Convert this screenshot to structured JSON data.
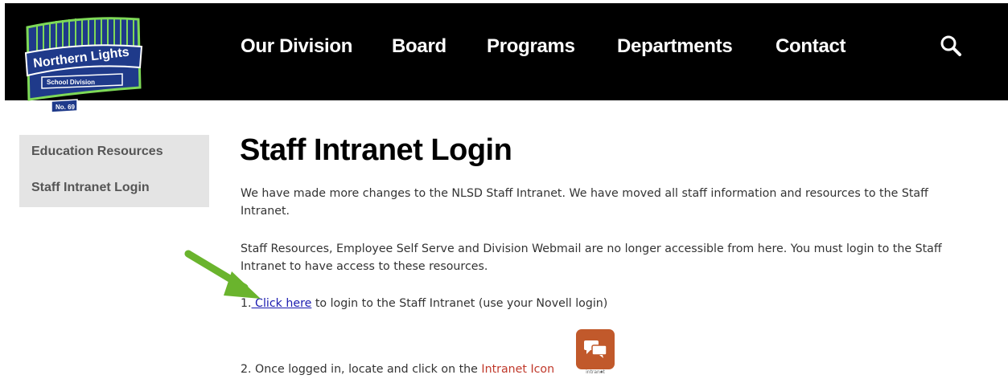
{
  "logo": {
    "line1": "Northern Lights",
    "line2": "School Division",
    "line3": "No. 69"
  },
  "nav": {
    "items": [
      {
        "label": "Our Division"
      },
      {
        "label": "Board"
      },
      {
        "label": "Programs"
      },
      {
        "label": "Departments"
      },
      {
        "label": "Contact"
      }
    ]
  },
  "sidebar": {
    "items": [
      {
        "label": "Education Resources"
      },
      {
        "label": "Staff Intranet Login"
      }
    ]
  },
  "main": {
    "title": "Staff Intranet Login",
    "paragraph1": "We have made more changes to the NLSD Staff Intranet.  We have moved all staff information and resources to the Staff Intranet.",
    "paragraph2": "Staff Resources, Employee Self Serve and Division Webmail are no longer accessible from here.  You must login to the Staff Intranet to have access to these resources.",
    "step1": {
      "number": "1.",
      "link": " Click here",
      "text": " to login to the Staff Intranet (use your Novell login)"
    },
    "step2": {
      "text_before": "2. Once logged in, locate and click on the ",
      "highlight": "Intranet Icon",
      "text_after": " .",
      "icon_label": "intranet"
    }
  },
  "colors": {
    "header_bg": "#000000",
    "sidebar_bg": "#e4e4e4",
    "link": "#1b1bb0",
    "highlight": "#c0392b",
    "arrow": "#6ab42d",
    "icon_bg": "#c1592b"
  },
  "icons": {
    "search": "search-icon",
    "arrow": "arrow-icon",
    "intranet": "chat-bubbles-icon"
  }
}
